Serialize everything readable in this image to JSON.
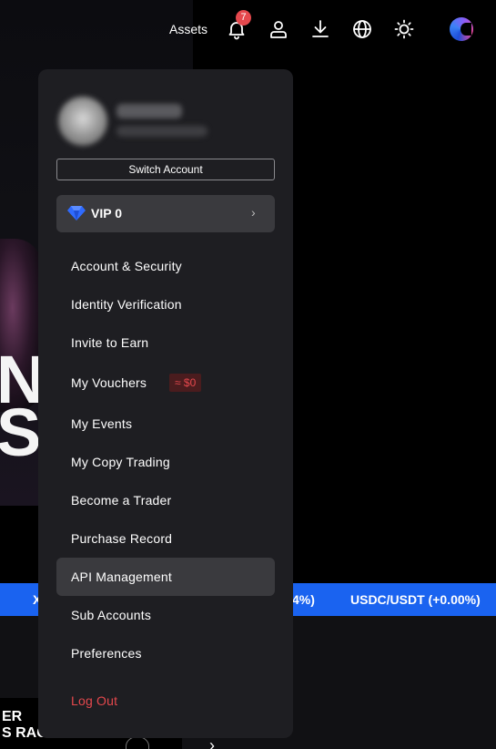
{
  "topnav": {
    "assets_label": "Assets",
    "notification_count": "7",
    "icons": [
      "bell-icon",
      "user-icon",
      "download-icon",
      "globe-icon",
      "sun-icon",
      "avatar"
    ]
  },
  "menu": {
    "switch_account_label": "Switch Account",
    "vip": {
      "label": "VIP 0",
      "chevron": "›"
    },
    "items": [
      {
        "label": "Account & Security"
      },
      {
        "label": "Identity Verification"
      },
      {
        "label": "Invite to Earn"
      },
      {
        "label": "My Vouchers",
        "badge": "≈ $0"
      },
      {
        "label": "My Events"
      },
      {
        "label": "My Copy Trading"
      },
      {
        "label": "Become a Trader"
      },
      {
        "label": "Purchase Record"
      },
      {
        "label": "API Management",
        "highlighted": true
      },
      {
        "label": "Sub Accounts"
      },
      {
        "label": "Preferences"
      }
    ],
    "logout_label": "Log Out"
  },
  "background": {
    "hero_text_1": "N",
    "hero_text_2": "SS",
    "ticker": {
      "left": "X",
      "mid": "4%)",
      "right": "USDC/USDT (+0.00%)"
    },
    "promo_line_1": "ER",
    "promo_line_2": "S RACE"
  },
  "colors": {
    "accent_blue": "#1a63f0",
    "danger_red": "#e5484d",
    "menu_bg": "#1e1e22",
    "highlight_bg": "#3a3a3e"
  }
}
